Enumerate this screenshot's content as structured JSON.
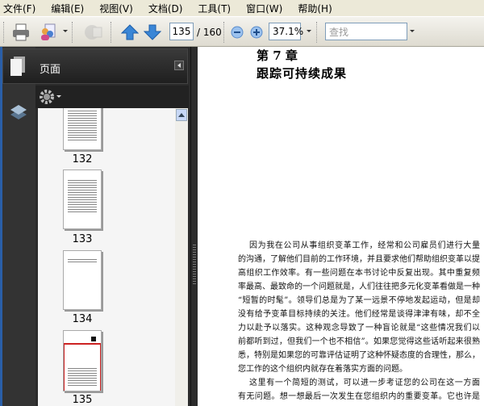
{
  "menu": [
    "文件(F)",
    "编辑(E)",
    "视图(V)",
    "文档(D)",
    "工具(T)",
    "窗口(W)",
    "帮助(H)"
  ],
  "toolbar": {
    "page_current": "135",
    "page_total": "/ 160",
    "zoom": "37.1%",
    "search_placeholder": "查找"
  },
  "sidebar": {
    "title": "页面",
    "thumbnails": [
      {
        "label": "132"
      },
      {
        "label": "133"
      },
      {
        "label": "134"
      },
      {
        "label": "135",
        "selected": true
      }
    ]
  },
  "document": {
    "chapter": "第 7 章",
    "title": "跟踪可持续成果",
    "lines": [
      "因为我在公司从事组织变革工作，经常和公司雇员们进行大量",
      "的沟通，了解他们目前的工作环境，并且要求他们帮助组织变革以提",
      "高组织工作效率。有一些问题在本书讨论中反复出现。其中重复频",
      "率最高、最致命的一个问题就是，人们往往把多元化变革看做是一种",
      "“短暂的时髦”。领导们总是为了某一远景不停地发起运动，但是却",
      "没有给予变革目标持续的关注。他们经常是谈得津津有味，却不全",
      "力以赴予以落实。这种观念导致了一种盲论就是“这些情况我们以",
      "前都听到过，但我们一个也不相信”。如果您觉得这些话听起来很熟",
      "悉，特别是如果您的可靠评估证明了这种怀疑态度的合理性，那么，",
      "您工作的这个组织内就存在着落实方面的问题。",
      "这里有一个简短的测试，可以进一步考证您的公司在这一方面",
      "有无问题。想一想最后一次发生在您组织内的重要变革。它也许是"
    ]
  },
  "colors": {
    "selected_border": "#cc2222",
    "pane_bg": "#2b2b2b"
  }
}
